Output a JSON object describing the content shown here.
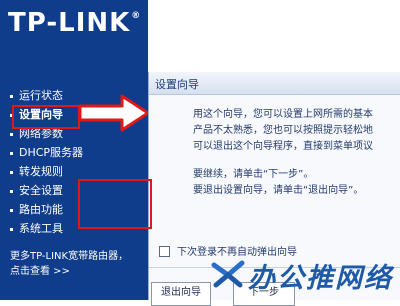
{
  "brand": {
    "logo_text": "TP-LINK",
    "registered": "®"
  },
  "nav": {
    "items": [
      {
        "label": "运行状态"
      },
      {
        "label": "设置向导",
        "active": true
      },
      {
        "label": "网络参数"
      },
      {
        "label": "DHCP服务器"
      },
      {
        "label": "转发规则"
      },
      {
        "label": "安全设置"
      },
      {
        "label": "路由功能"
      },
      {
        "label": "系统工具"
      }
    ],
    "more_line1": "更多TP-LINK宽带路由器，",
    "more_line2": "点击查看 >>"
  },
  "dialog": {
    "title": "设置向导",
    "intro_lines": [
      "用这个向导，您可以设置上网所需的基本",
      "产品不太熟悉，您也可以按照提示轻松地",
      "可以退出这个向导程序，直接到菜单项议"
    ],
    "next_hint": "要继续，请单击“下一步”。",
    "exit_hint": "要退出设置向导，请单击“退出向导”。",
    "checkbox_label": "下次登录不再自动弹出向导",
    "checkbox_checked": false,
    "exit_button": "退出向导",
    "next_button": "下一步"
  },
  "watermark": {
    "text": "办公推网络"
  },
  "colors": {
    "panel_blue": "#0f3d8c",
    "highlight_red": "#e01818",
    "dialog_text": "#243a6b"
  }
}
